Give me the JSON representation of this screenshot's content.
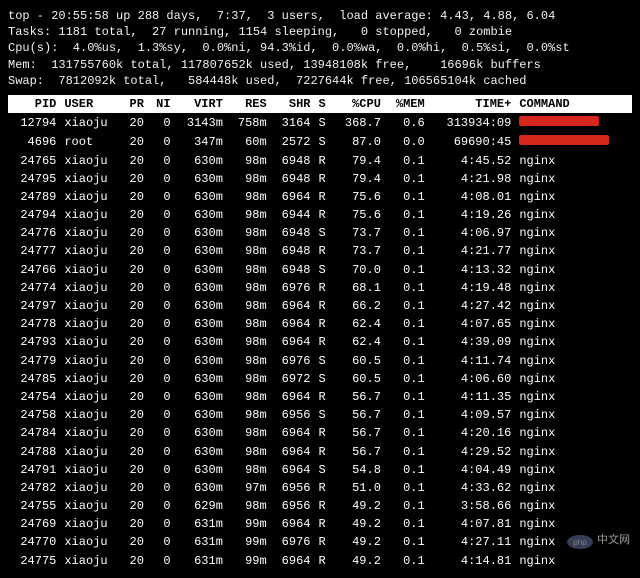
{
  "summary": {
    "line1": "top - 20:55:58 up 288 days,  7:37,  3 users,  load average: 4.43, 4.88, 6.04",
    "line2": "Tasks: 1181 total,  27 running, 1154 sleeping,   0 stopped,   0 zombie",
    "line3": "Cpu(s):  4.0%us,  1.3%sy,  0.0%ni, 94.3%id,  0.0%wa,  0.0%hi,  0.5%si,  0.0%st",
    "line4": "Mem:  131755760k total, 117807652k used, 13948108k free,    16696k buffers",
    "line5": "Swap:  7812092k total,   584448k used,  7227644k free, 106565104k cached"
  },
  "headers": {
    "pid": "PID",
    "user": "USER",
    "pr": "PR",
    "ni": "NI",
    "virt": "VIRT",
    "res": "RES",
    "shr": "SHR",
    "s": "S",
    "cpu": "%CPU",
    "mem": "%MEM",
    "time": "TIME+",
    "command": "COMMAND"
  },
  "rows": [
    {
      "pid": "12794",
      "user": "xiaoju",
      "pr": "20",
      "ni": "0",
      "virt": "3143m",
      "res": "758m",
      "shr": "3164",
      "s": "S",
      "cpu": "368.7",
      "mem": "0.6",
      "time": "313934:09",
      "command": "",
      "redact": 80
    },
    {
      "pid": "4696",
      "user": "root",
      "pr": "20",
      "ni": "0",
      "virt": "347m",
      "res": "60m",
      "shr": "2572",
      "s": "S",
      "cpu": "87.0",
      "mem": "0.0",
      "time": "69690:45",
      "command": "",
      "redact": 90
    },
    {
      "pid": "24765",
      "user": "xiaoju",
      "pr": "20",
      "ni": "0",
      "virt": "630m",
      "res": "98m",
      "shr": "6948",
      "s": "R",
      "cpu": "79.4",
      "mem": "0.1",
      "time": "4:45.52",
      "command": "nginx"
    },
    {
      "pid": "24795",
      "user": "xiaoju",
      "pr": "20",
      "ni": "0",
      "virt": "630m",
      "res": "98m",
      "shr": "6948",
      "s": "R",
      "cpu": "79.4",
      "mem": "0.1",
      "time": "4:21.98",
      "command": "nginx"
    },
    {
      "pid": "24789",
      "user": "xiaoju",
      "pr": "20",
      "ni": "0",
      "virt": "630m",
      "res": "98m",
      "shr": "6964",
      "s": "R",
      "cpu": "75.6",
      "mem": "0.1",
      "time": "4:08.01",
      "command": "nginx"
    },
    {
      "pid": "24794",
      "user": "xiaoju",
      "pr": "20",
      "ni": "0",
      "virt": "630m",
      "res": "98m",
      "shr": "6944",
      "s": "R",
      "cpu": "75.6",
      "mem": "0.1",
      "time": "4:19.26",
      "command": "nginx"
    },
    {
      "pid": "24776",
      "user": "xiaoju",
      "pr": "20",
      "ni": "0",
      "virt": "630m",
      "res": "98m",
      "shr": "6948",
      "s": "S",
      "cpu": "73.7",
      "mem": "0.1",
      "time": "4:06.97",
      "command": "nginx"
    },
    {
      "pid": "24777",
      "user": "xiaoju",
      "pr": "20",
      "ni": "0",
      "virt": "630m",
      "res": "98m",
      "shr": "6948",
      "s": "R",
      "cpu": "73.7",
      "mem": "0.1",
      "time": "4:21.77",
      "command": "nginx"
    },
    {
      "pid": "24766",
      "user": "xiaoju",
      "pr": "20",
      "ni": "0",
      "virt": "630m",
      "res": "98m",
      "shr": "6948",
      "s": "S",
      "cpu": "70.0",
      "mem": "0.1",
      "time": "4:13.32",
      "command": "nginx"
    },
    {
      "pid": "24774",
      "user": "xiaoju",
      "pr": "20",
      "ni": "0",
      "virt": "630m",
      "res": "98m",
      "shr": "6976",
      "s": "R",
      "cpu": "68.1",
      "mem": "0.1",
      "time": "4:19.48",
      "command": "nginx"
    },
    {
      "pid": "24797",
      "user": "xiaoju",
      "pr": "20",
      "ni": "0",
      "virt": "630m",
      "res": "98m",
      "shr": "6964",
      "s": "R",
      "cpu": "66.2",
      "mem": "0.1",
      "time": "4:27.42",
      "command": "nginx"
    },
    {
      "pid": "24778",
      "user": "xiaoju",
      "pr": "20",
      "ni": "0",
      "virt": "630m",
      "res": "98m",
      "shr": "6964",
      "s": "R",
      "cpu": "62.4",
      "mem": "0.1",
      "time": "4:07.65",
      "command": "nginx"
    },
    {
      "pid": "24793",
      "user": "xiaoju",
      "pr": "20",
      "ni": "0",
      "virt": "630m",
      "res": "98m",
      "shr": "6964",
      "s": "R",
      "cpu": "62.4",
      "mem": "0.1",
      "time": "4:39.09",
      "command": "nginx"
    },
    {
      "pid": "24779",
      "user": "xiaoju",
      "pr": "20",
      "ni": "0",
      "virt": "630m",
      "res": "98m",
      "shr": "6976",
      "s": "S",
      "cpu": "60.5",
      "mem": "0.1",
      "time": "4:11.74",
      "command": "nginx"
    },
    {
      "pid": "24785",
      "user": "xiaoju",
      "pr": "20",
      "ni": "0",
      "virt": "630m",
      "res": "98m",
      "shr": "6972",
      "s": "S",
      "cpu": "60.5",
      "mem": "0.1",
      "time": "4:06.60",
      "command": "nginx"
    },
    {
      "pid": "24754",
      "user": "xiaoju",
      "pr": "20",
      "ni": "0",
      "virt": "630m",
      "res": "98m",
      "shr": "6964",
      "s": "R",
      "cpu": "56.7",
      "mem": "0.1",
      "time": "4:11.35",
      "command": "nginx"
    },
    {
      "pid": "24758",
      "user": "xiaoju",
      "pr": "20",
      "ni": "0",
      "virt": "630m",
      "res": "98m",
      "shr": "6956",
      "s": "S",
      "cpu": "56.7",
      "mem": "0.1",
      "time": "4:09.57",
      "command": "nginx"
    },
    {
      "pid": "24784",
      "user": "xiaoju",
      "pr": "20",
      "ni": "0",
      "virt": "630m",
      "res": "98m",
      "shr": "6964",
      "s": "R",
      "cpu": "56.7",
      "mem": "0.1",
      "time": "4:20.16",
      "command": "nginx"
    },
    {
      "pid": "24788",
      "user": "xiaoju",
      "pr": "20",
      "ni": "0",
      "virt": "630m",
      "res": "98m",
      "shr": "6964",
      "s": "R",
      "cpu": "56.7",
      "mem": "0.1",
      "time": "4:29.52",
      "command": "nginx"
    },
    {
      "pid": "24791",
      "user": "xiaoju",
      "pr": "20",
      "ni": "0",
      "virt": "630m",
      "res": "98m",
      "shr": "6964",
      "s": "S",
      "cpu": "54.8",
      "mem": "0.1",
      "time": "4:04.49",
      "command": "nginx"
    },
    {
      "pid": "24782",
      "user": "xiaoju",
      "pr": "20",
      "ni": "0",
      "virt": "630m",
      "res": "97m",
      "shr": "6956",
      "s": "R",
      "cpu": "51.0",
      "mem": "0.1",
      "time": "4:33.62",
      "command": "nginx"
    },
    {
      "pid": "24755",
      "user": "xiaoju",
      "pr": "20",
      "ni": "0",
      "virt": "629m",
      "res": "98m",
      "shr": "6956",
      "s": "R",
      "cpu": "49.2",
      "mem": "0.1",
      "time": "3:58.66",
      "command": "nginx"
    },
    {
      "pid": "24769",
      "user": "xiaoju",
      "pr": "20",
      "ni": "0",
      "virt": "631m",
      "res": "99m",
      "shr": "6964",
      "s": "R",
      "cpu": "49.2",
      "mem": "0.1",
      "time": "4:07.81",
      "command": "nginx"
    },
    {
      "pid": "24770",
      "user": "xiaoju",
      "pr": "20",
      "ni": "0",
      "virt": "631m",
      "res": "99m",
      "shr": "6976",
      "s": "R",
      "cpu": "49.2",
      "mem": "0.1",
      "time": "4:27.11",
      "command": "nginx"
    },
    {
      "pid": "24775",
      "user": "xiaoju",
      "pr": "20",
      "ni": "0",
      "virt": "631m",
      "res": "99m",
      "shr": "6964",
      "s": "R",
      "cpu": "49.2",
      "mem": "0.1",
      "time": "4:14.81",
      "command": "nginx"
    }
  ],
  "watermark": "中文网"
}
